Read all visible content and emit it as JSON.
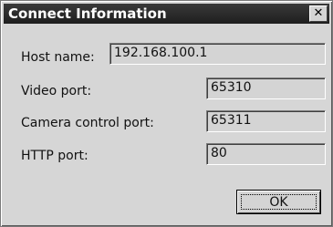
{
  "dialog": {
    "title": "Connect Information",
    "close_glyph": "✕",
    "close_icon": "close-icon"
  },
  "fields": {
    "host_name": {
      "label": "Host name:",
      "value": "192.168.100.1"
    },
    "video_port": {
      "label": "Video port:",
      "value": "65310"
    },
    "camera_control_port": {
      "label": "Camera control port:",
      "value": "65311"
    },
    "http_port": {
      "label": "HTTP port:",
      "value": "80"
    }
  },
  "buttons": {
    "ok": "OK"
  }
}
